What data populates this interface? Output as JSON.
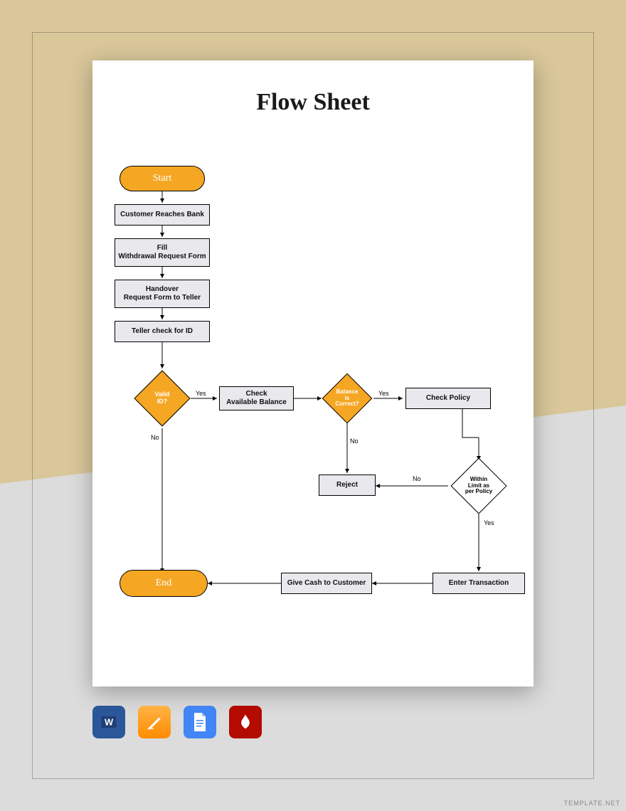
{
  "title": "Flow Sheet",
  "nodes": {
    "start": "Start",
    "end": "End",
    "reach": "Customer Reaches Bank",
    "fill": "Fill\nWithdrawal Request Form",
    "handover": "Handover\nRequest Form to Teller",
    "teller": "Teller check for ID",
    "valid": "Valid\nID?",
    "check_balance": "Check\nAvailable Balance",
    "balance_correct": "Balance\nis\nCorrect?",
    "check_policy": "Check Policy",
    "reject": "Reject",
    "within_limit": "Within\nLimit as\nper Policy",
    "enter_trans": "Enter Transaction",
    "give_cash": "Give Cash to Customer"
  },
  "labels": {
    "yes": "Yes",
    "no": "No"
  },
  "icons": [
    "word",
    "pages",
    "google-docs",
    "pdf"
  ],
  "brand": "TEMPLATE.NET"
}
